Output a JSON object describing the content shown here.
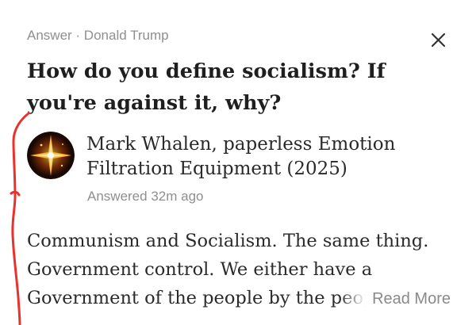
{
  "header": {
    "label": "Answer",
    "separator": " · ",
    "topic": "Donald Trump"
  },
  "question": {
    "title": "How do you define socialism? If you're against it, why?"
  },
  "author": {
    "name": "Mark Whalen, paperless Emotion Filtration Equipment (2025)",
    "answered": "Answered 32m ago",
    "avatar_icon": "starburst-avatar-icon"
  },
  "answer": {
    "lines": [
      "Communism and Socialism. The same thing.",
      "Government control. We either have a",
      "Government of the people by the people"
    ],
    "read_more": "Read More"
  },
  "icons": {
    "close": "close-icon",
    "annotation": "red-pen-annotation-line"
  },
  "colors": {
    "meta_text": "#8f8f8f",
    "title_text": "#1f1f1f",
    "body_text": "#2a2a2a",
    "annotation": "#e8322d"
  }
}
